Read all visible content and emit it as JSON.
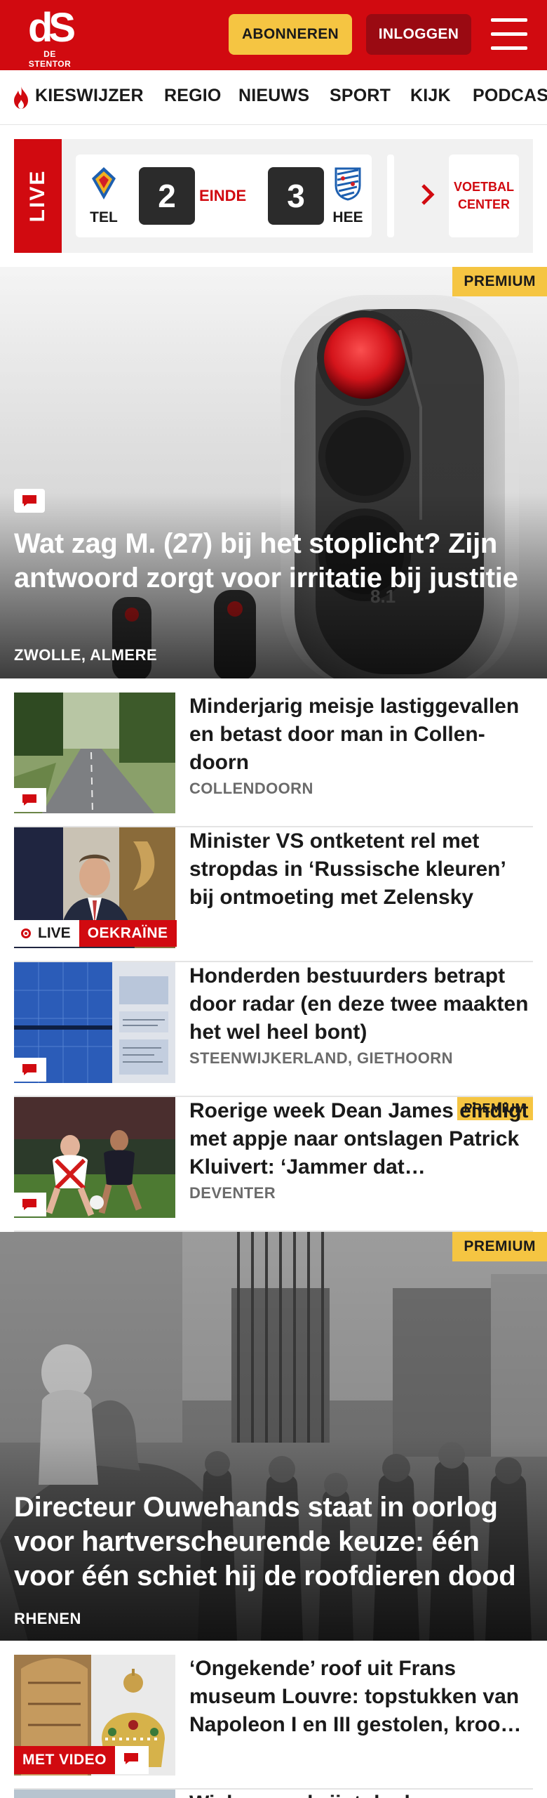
{
  "header": {
    "logo_mark": "dS",
    "logo_name": "DE STENTOR",
    "subscribe_label": "ABONNEREN",
    "login_label": "INLOGGEN",
    "brand_color": "#d10a10",
    "accent_color": "#f5c542"
  },
  "nav": {
    "items": [
      {
        "label": "KIESWIJZER",
        "icon": "flame-icon"
      },
      {
        "label": "REGIO"
      },
      {
        "label": "NIEUWS"
      },
      {
        "label": "SPORT"
      },
      {
        "label": "KIJK"
      },
      {
        "label": "PODCAS"
      }
    ]
  },
  "live": {
    "tag": "LIVE",
    "home_team": "TEL",
    "home_score": "2",
    "status": "EINDE",
    "away_score": "3",
    "away_team": "HEE",
    "center_label": "VOETBAL CENTER"
  },
  "hero1": {
    "badge": "PREMIUM",
    "title": "Wat zag M. (27) bij het stoplicht? Zijn antwoord zorgt voor irritatie bij justitie",
    "location": "ZWOLLE, ALMERE"
  },
  "articles": [
    {
      "title": "Minderjarig meisje lastiggevallen en betast door man in Collen­doorn",
      "location": "COLLENDOORN"
    },
    {
      "title": "Minister VS ontketent rel met stropdas in ‘Russische kleuren’ bij ontmoeting met Zelensky",
      "live_label": "LIVE",
      "tag": "OEKRAÏNE"
    },
    {
      "title": "Honderden bestuurders betrapt door radar (en deze twee maakten het wel heel bont)",
      "location": "STEENWIJKERLAND, GIETHOORN"
    },
    {
      "title": "Roerige week Dean James eindigt met appje naar ontslagen Patrick Kluivert: ‘Jammer dat…",
      "location": "DEVENTER",
      "badge": "PREMIUM"
    }
  ],
  "hero2": {
    "badge": "PREMIUM",
    "title": "Directeur Ouwehands staat in oorlog voor hartverscheurende keuze: één voor één schiet hij de roofdieren dood",
    "location": "RHENEN"
  },
  "article_video": {
    "title": "‘Ongekende’ roof uit Frans museum Louvre: topstukken van Napoleon I en III gestolen, kroo…",
    "video_label": "MET VIDEO"
  },
  "next_teaser": {
    "title": "Wiebes verdwijnt doek"
  }
}
